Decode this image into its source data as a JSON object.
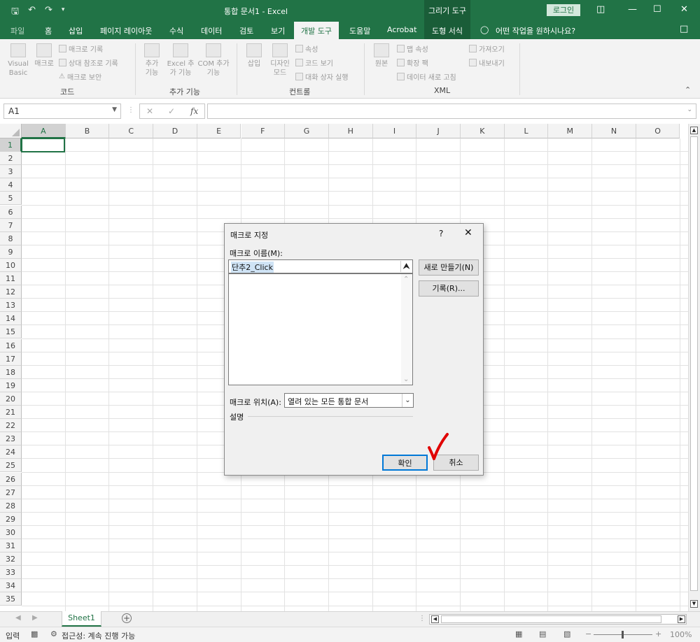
{
  "title_bar": {
    "doc_title": "통합 문서1  -  Excel",
    "context_group": "그리기 도구",
    "login": "로그인",
    "qat_icons": [
      "save-icon",
      "undo-icon",
      "redo-icon",
      "customize-icon"
    ]
  },
  "tabs": {
    "file": "파일",
    "home": "홈",
    "insert": "삽입",
    "page_layout": "페이지 레이아웃",
    "formulas": "수식",
    "data": "데이터",
    "review": "검토",
    "view": "보기",
    "developer": "개발 도구",
    "help": "도움말",
    "acrobat": "Acrobat",
    "shape_format": "도형 서식",
    "tell_me": "어떤 작업을 원하시나요?"
  },
  "ribbon": {
    "code": {
      "visual_basic": "Visual Basic",
      "macros": "매크로",
      "record_macro": "매크로 기록",
      "relative_ref": "상대 참조로 기록",
      "macro_security": "매크로 보안",
      "label": "코드"
    },
    "addins": {
      "addins": "추가 기능",
      "excel_addins": "Excel 추가 기능",
      "com_addins": "COM 추가 기능",
      "label": "추가 기능"
    },
    "controls": {
      "insert": "삽입",
      "design_mode": "디자인 모드",
      "properties": "속성",
      "view_code": "코드 보기",
      "run_dialog": "대화 상자 실행",
      "label": "컨트롤"
    },
    "xml": {
      "source": "원본",
      "map_properties": "맵 속성",
      "expansion_packs": "확장 팩",
      "refresh_data": "데이터 새로 고침",
      "import": "가져오기",
      "export": "내보내기",
      "label": "XML"
    }
  },
  "formula_bar": {
    "name_box": "A1",
    "formula": ""
  },
  "grid": {
    "columns": [
      "A",
      "B",
      "C",
      "D",
      "E",
      "F",
      "G",
      "H",
      "I",
      "J",
      "K",
      "L",
      "M",
      "N",
      "O"
    ],
    "rows": [
      "1",
      "2",
      "3",
      "4",
      "5",
      "6",
      "7",
      "8",
      "9",
      "10",
      "11",
      "12",
      "13",
      "14",
      "15",
      "16",
      "17",
      "18",
      "19",
      "20",
      "21",
      "22",
      "23",
      "24",
      "25",
      "26",
      "27",
      "28",
      "29",
      "30",
      "31",
      "32",
      "33",
      "34",
      "35"
    ],
    "selected_cell": "A1"
  },
  "dialog": {
    "title": "매크로 지정",
    "help": "?",
    "macro_name_label": "매크로 이름(M):",
    "macro_name_value": "단추2_Click",
    "new_button": "새로 만들기(N)",
    "record_button": "기록(R)...",
    "location_label": "매크로 위치(A):",
    "location_value": "열려 있는 모든 통합 문서",
    "description_label": "설명",
    "ok_button": "확인",
    "cancel_button": "취소",
    "annotation_color": "#e00000"
  },
  "sheet_tabs": {
    "active": "Sheet1"
  },
  "status_bar": {
    "mode": "입력",
    "accessibility": "접근성: 계속 진행 가능",
    "zoom": "100%"
  },
  "colors": {
    "excel_green": "#217346",
    "context_green": "#1a5d38"
  }
}
